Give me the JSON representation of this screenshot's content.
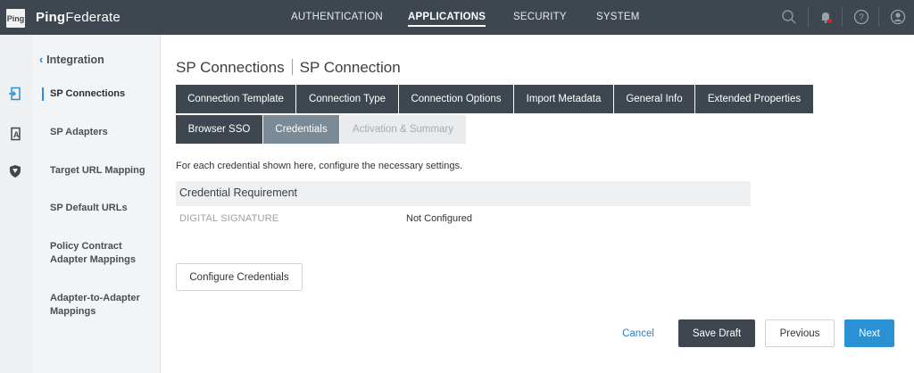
{
  "app": {
    "logo_text": "Ping",
    "brand_bold": "Ping",
    "brand_rest": "Federate"
  },
  "topnav": [
    {
      "label": "AUTHENTICATION",
      "active": false
    },
    {
      "label": "APPLICATIONS",
      "active": true
    },
    {
      "label": "SECURITY",
      "active": false
    },
    {
      "label": "SYSTEM",
      "active": false
    }
  ],
  "top_icons": [
    "search-icon",
    "bell-icon",
    "help-icon",
    "user-icon"
  ],
  "colors": {
    "topbar": "#3e474f",
    "accent_blue": "#2a92d4",
    "notification_dot": "#e02020",
    "tab_current": "#7b8a97"
  },
  "sidebar": {
    "back_label": "Integration",
    "items": [
      {
        "label": "SP Connections",
        "active": true
      },
      {
        "label": "SP Adapters"
      },
      {
        "label": "Target URL Mapping"
      },
      {
        "label": "SP Default URLs"
      },
      {
        "label": "Policy Contract Adapter Mappings"
      },
      {
        "label": "Adapter-to-Adapter Mappings"
      }
    ]
  },
  "page": {
    "title_part1": "SP Connections",
    "title_part2": "SP Connection"
  },
  "tabs_row1": [
    "Connection Template",
    "Connection Type",
    "Connection Options",
    "Import Metadata",
    "General Info",
    "Extended Properties"
  ],
  "tabs_row2": [
    "Browser SSO",
    "Credentials",
    "Activation & Summary"
  ],
  "main": {
    "intro": "For each credential shown here, configure the necessary settings.",
    "table_header": "Credential Requirement",
    "row_name": "DIGITAL SIGNATURE",
    "row_status": "Not Configured",
    "configure_button": "Configure Credentials"
  },
  "footer": {
    "cancel": "Cancel",
    "save_draft": "Save Draft",
    "previous": "Previous",
    "next": "Next"
  }
}
